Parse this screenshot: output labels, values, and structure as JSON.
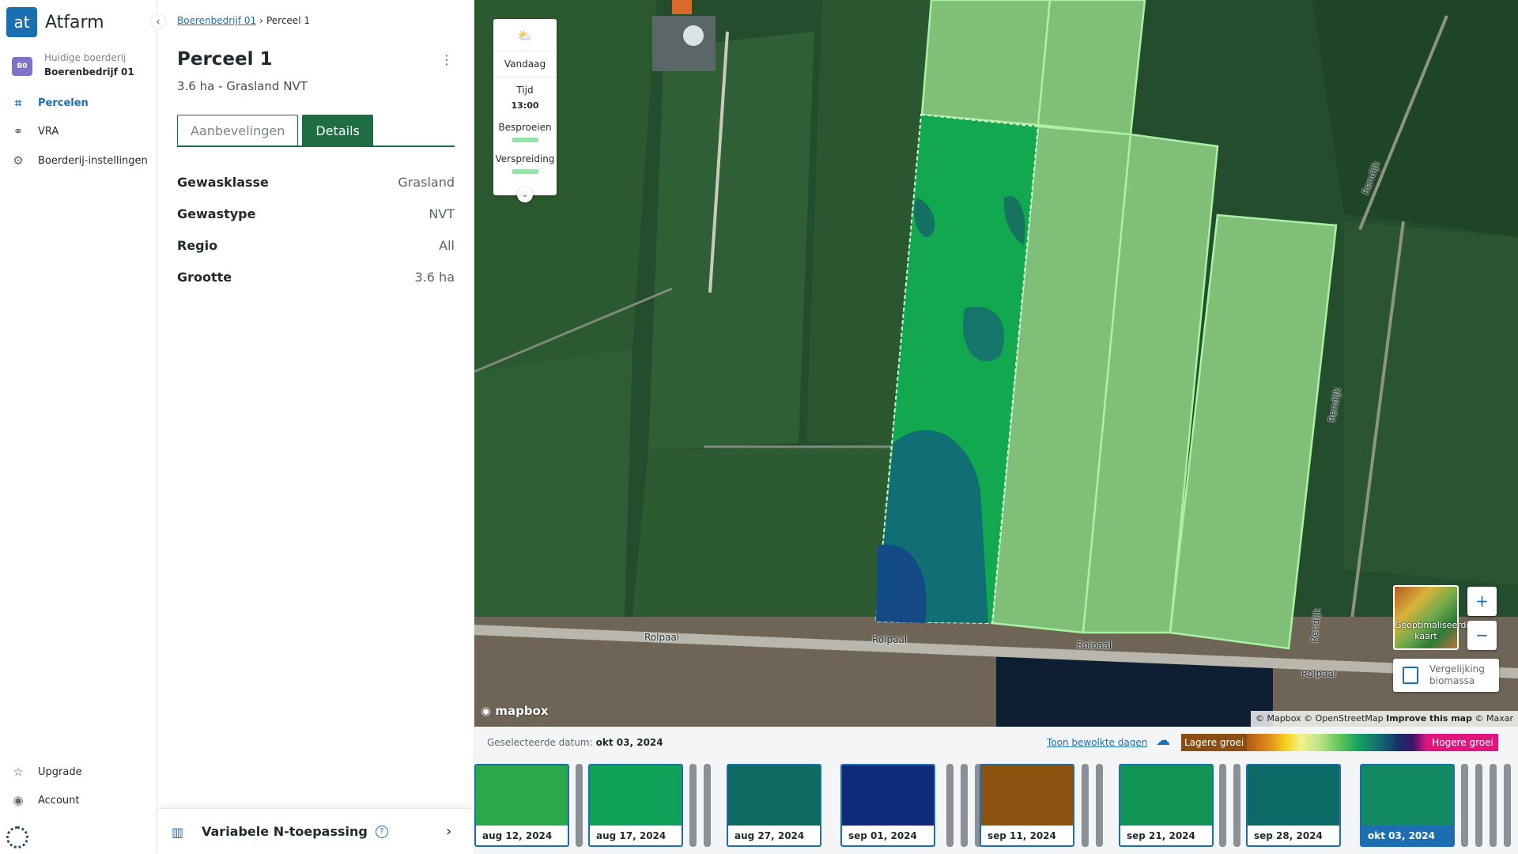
{
  "app": {
    "logo_text": "at",
    "name": "Atfarm"
  },
  "nav": {
    "farm_caption": "Huidige boerderij",
    "farm_name": "Boerenbedrijf 01",
    "farm_badge": "B0",
    "items": [
      {
        "label": "Percelen",
        "icon": "fields-icon"
      },
      {
        "label": "VRA",
        "icon": "vra-icon"
      },
      {
        "label": "Boerderij-instellingen",
        "icon": "gear-icon"
      }
    ],
    "bottom_items": [
      {
        "label": "Upgrade",
        "icon": "star-icon"
      },
      {
        "label": "Account",
        "icon": "account-icon"
      }
    ]
  },
  "panel": {
    "breadcrumb": {
      "farm": "Boerenbedrijf 01",
      "field": "Perceel 1"
    },
    "title": "Perceel 1",
    "subtitle": "3.6 ha - Grasland NVT",
    "tabs": [
      {
        "label": "Aanbevelingen",
        "active": false
      },
      {
        "label": "Details",
        "active": true
      }
    ],
    "details": [
      {
        "key": "Gewasklasse",
        "value": "Grasland"
      },
      {
        "key": "Gewastype",
        "value": "NVT"
      },
      {
        "key": "Regio",
        "value": "All"
      },
      {
        "key": "Grootte",
        "value": "3.6 ha"
      }
    ],
    "footer_label": "Variabele N-toepassing"
  },
  "weather": {
    "day": "Vandaag",
    "time_label": "Tijd",
    "time": "13:00",
    "spray_label": "Besproeien",
    "spread_label": "Verspreiding",
    "spray_color": "#95e3a8"
  },
  "map": {
    "roads": [
      "Rolpaal",
      "Rolpaal",
      "Rolpaal",
      "Rolpaal",
      "Rendijk",
      "Rendijk",
      "Rendijk"
    ],
    "thumb_label": "Geoptimaliseerde kaart",
    "compare_label_1": "Vergelijking",
    "compare_label_2": "biomassa",
    "zoom_in": "+",
    "zoom_out": "−",
    "logo": "mapbox",
    "attribution": {
      "a": "© Mapbox © OpenStreetMap",
      "b": "Improve this map",
      "c": "© Maxar"
    }
  },
  "timeline": {
    "selected_label": "Geselecteerde datum:",
    "selected_date": "okt 03, 2024",
    "cloud_link": "Toon bewolkte dagen",
    "legend_low": "Lagere groei",
    "legend_high": "Hogere groei",
    "dates": [
      {
        "label": "aug 12, 2024",
        "color": "#2aa84a",
        "selected": false
      },
      {
        "label": "aug 17, 2024",
        "color": "#11a25a",
        "selected": false
      },
      {
        "label": "aug 27, 2024",
        "color": "#0f6a62",
        "selected": false
      },
      {
        "label": "sep 01, 2024",
        "color": "#0f2a78",
        "selected": false
      },
      {
        "label": "sep 11, 2024",
        "color": "#8a5410",
        "selected": false
      },
      {
        "label": "sep 21, 2024",
        "color": "#129454",
        "selected": false
      },
      {
        "label": "sep 28, 2024",
        "color": "#0e6a66",
        "selected": false
      },
      {
        "label": "okt 03, 2024",
        "color": "#128a64",
        "selected": true
      }
    ]
  }
}
